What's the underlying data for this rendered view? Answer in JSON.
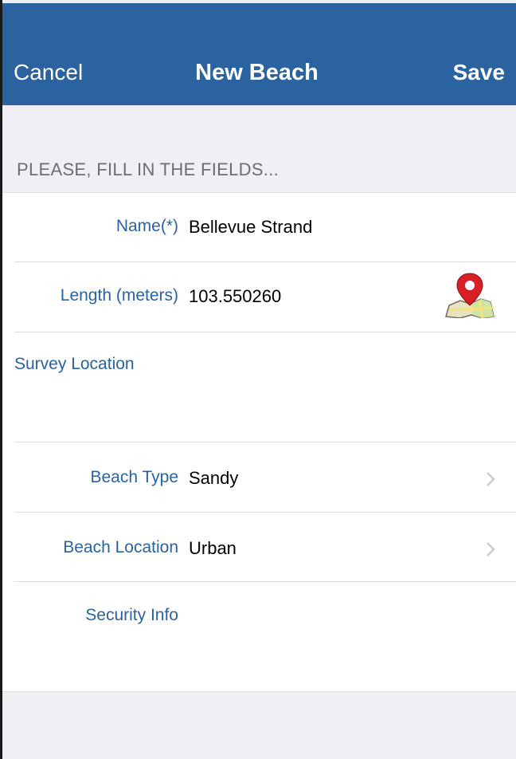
{
  "nav": {
    "cancel_label": "Cancel",
    "title": "New Beach",
    "save_label": "Save"
  },
  "section_header": "PLEASE, FILL IN THE FIELDS...",
  "fields": {
    "name": {
      "label": "Name(*)",
      "value": "Bellevue Strand"
    },
    "length": {
      "label": "Length (meters)",
      "value": "103.550260",
      "icon": "map-pin-icon"
    },
    "survey_location": {
      "label": "Survey Location",
      "value": ""
    },
    "beach_type": {
      "label": "Beach Type",
      "value": "Sandy",
      "icon": "chevron-right-icon"
    },
    "beach_location": {
      "label": "Beach Location",
      "value": "Urban",
      "icon": "chevron-right-icon"
    },
    "security_info": {
      "label": "Security Info",
      "value": ""
    }
  },
  "colors": {
    "nav_background": "#2a63a0",
    "label_blue": "#2a63a0",
    "pin_red": "#d81f26",
    "chevron_gray": "#c7c7cc"
  }
}
